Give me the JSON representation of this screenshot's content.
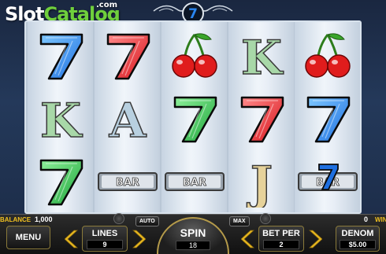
{
  "brand": {
    "slot": "Slot",
    "catalog": "Catalog",
    "com": ".com"
  },
  "reels": [
    [
      "seven-blue",
      "k",
      "seven-green"
    ],
    [
      "seven-red",
      "a",
      "bar"
    ],
    [
      "cherry",
      "seven-green",
      "bar"
    ],
    [
      "k",
      "seven-red",
      "j"
    ],
    [
      "cherry",
      "seven-blue",
      "seven-blue-bar"
    ]
  ],
  "symbols": {
    "k": "K",
    "a": "A",
    "j": "J",
    "bar": "BAR"
  },
  "colors": {
    "seven_blue": "#1e6fe0",
    "seven_red": "#d8141c",
    "seven_green": "#1ea53a",
    "cherry": "#e01c1c",
    "gold": "#f0c020"
  },
  "footer": {
    "balance_label": "BALANCE",
    "balance_value": "1,000",
    "win_value": "0",
    "win_label": "WIN",
    "menu_label": "MENU",
    "lines_label": "LINES",
    "lines_value": "9",
    "auto_label": "AUTO",
    "max_label": "MAX",
    "spin_label": "SPIN",
    "spin_value": "18",
    "bet_label": "BET PER",
    "bet_value": "2",
    "denom_label": "DENOM",
    "denom_value": "$5.00"
  }
}
